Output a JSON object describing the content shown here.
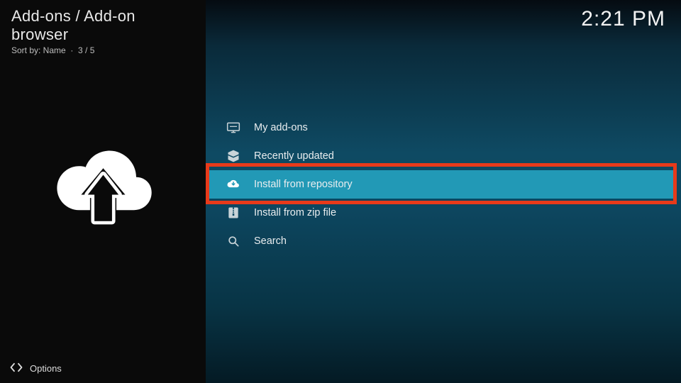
{
  "header": {
    "breadcrumb": "Add-ons / Add-on browser",
    "sort_label": "Sort by: Name",
    "position": "3 / 5"
  },
  "clock": "2:21 PM",
  "menu": {
    "items": [
      {
        "label": "My add-ons",
        "icon": "monitor",
        "selected": false
      },
      {
        "label": "Recently updated",
        "icon": "box",
        "selected": false
      },
      {
        "label": "Install from repository",
        "icon": "cloud-dl",
        "selected": true
      },
      {
        "label": "Install from zip file",
        "icon": "zip",
        "selected": false
      },
      {
        "label": "Search",
        "icon": "search",
        "selected": false
      }
    ]
  },
  "footer": {
    "options_label": "Options"
  },
  "annotation": {
    "highlight_index": 2
  }
}
